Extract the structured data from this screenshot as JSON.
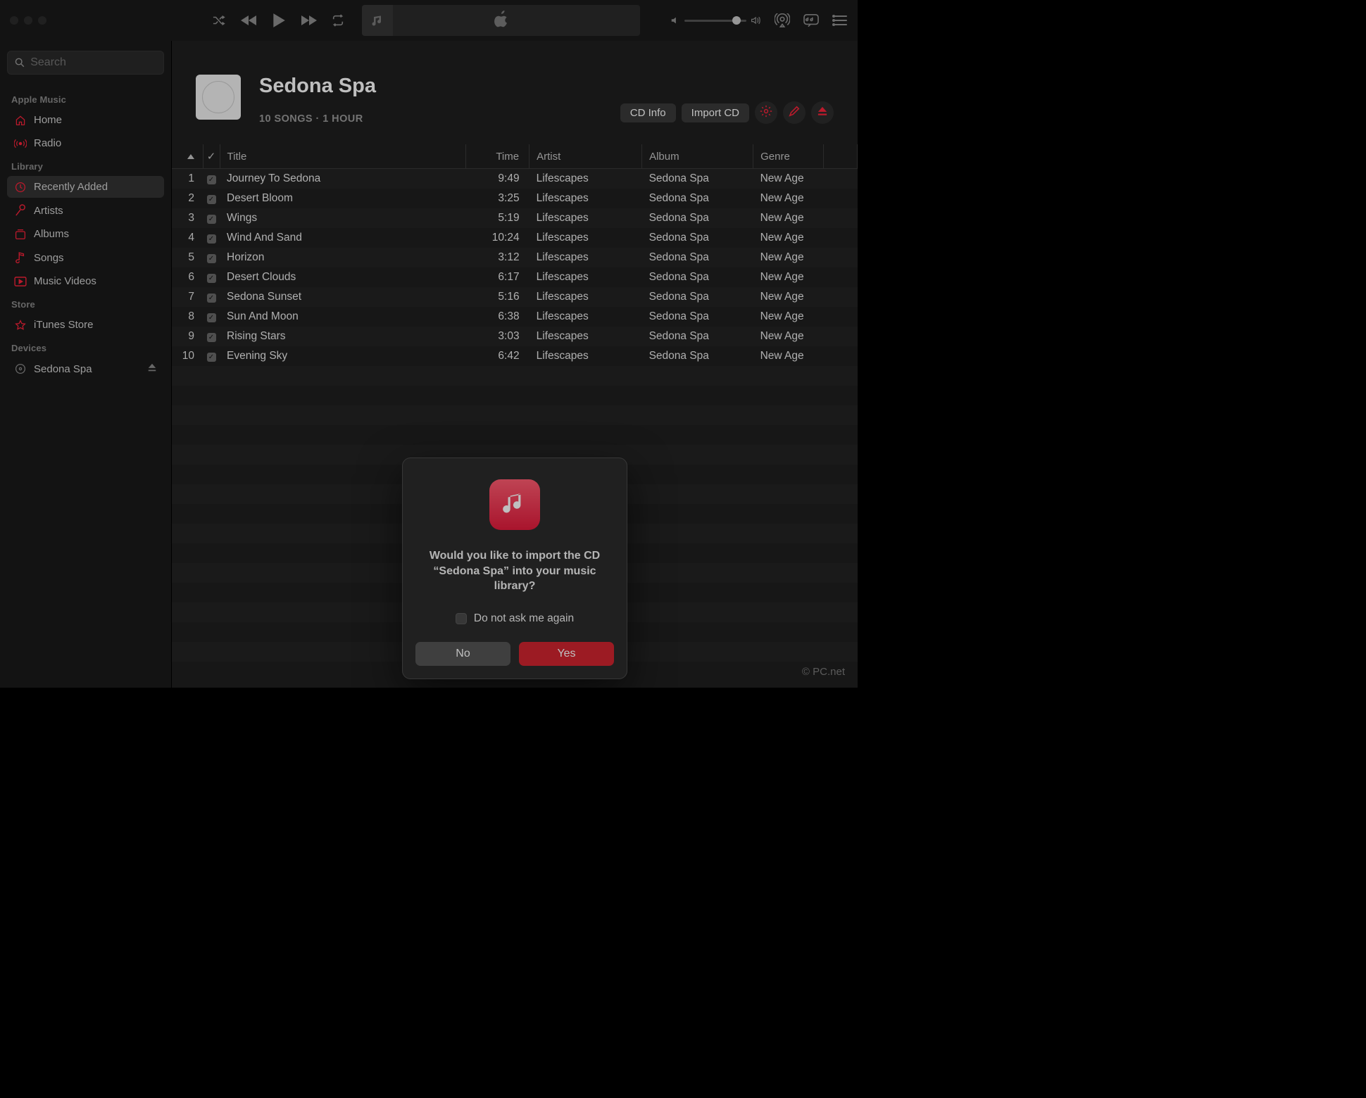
{
  "search": {
    "placeholder": "Search"
  },
  "sidebar": {
    "sections": {
      "apple_music": {
        "label": "Apple Music",
        "items": [
          {
            "label": "Home"
          },
          {
            "label": "Radio"
          }
        ]
      },
      "library": {
        "label": "Library",
        "items": [
          {
            "label": "Recently Added"
          },
          {
            "label": "Artists"
          },
          {
            "label": "Albums"
          },
          {
            "label": "Songs"
          },
          {
            "label": "Music Videos"
          }
        ]
      },
      "store": {
        "label": "Store",
        "items": [
          {
            "label": "iTunes Store"
          }
        ]
      },
      "devices": {
        "label": "Devices",
        "items": [
          {
            "label": "Sedona Spa"
          }
        ]
      }
    }
  },
  "header": {
    "title": "Sedona Spa",
    "subtitle": "10 SONGS · 1 HOUR",
    "cd_info": "CD Info",
    "import_cd": "Import CD"
  },
  "columns": {
    "num": "",
    "chk": "✓",
    "title": "Title",
    "time": "Time",
    "artist": "Artist",
    "album": "Album",
    "genre": "Genre"
  },
  "tracks": [
    {
      "n": "1",
      "title": "Journey To Sedona",
      "time": "9:49",
      "artist": "Lifescapes",
      "album": "Sedona Spa",
      "genre": "New Age"
    },
    {
      "n": "2",
      "title": "Desert Bloom",
      "time": "3:25",
      "artist": "Lifescapes",
      "album": "Sedona Spa",
      "genre": "New Age"
    },
    {
      "n": "3",
      "title": "Wings",
      "time": "5:19",
      "artist": "Lifescapes",
      "album": "Sedona Spa",
      "genre": "New Age"
    },
    {
      "n": "4",
      "title": "Wind And Sand",
      "time": "10:24",
      "artist": "Lifescapes",
      "album": "Sedona Spa",
      "genre": "New Age"
    },
    {
      "n": "5",
      "title": "Horizon",
      "time": "3:12",
      "artist": "Lifescapes",
      "album": "Sedona Spa",
      "genre": "New Age"
    },
    {
      "n": "6",
      "title": "Desert Clouds",
      "time": "6:17",
      "artist": "Lifescapes",
      "album": "Sedona Spa",
      "genre": "New Age"
    },
    {
      "n": "7",
      "title": "Sedona Sunset",
      "time": "5:16",
      "artist": "Lifescapes",
      "album": "Sedona Spa",
      "genre": "New Age"
    },
    {
      "n": "8",
      "title": "Sun And Moon",
      "time": "6:38",
      "artist": "Lifescapes",
      "album": "Sedona Spa",
      "genre": "New Age"
    },
    {
      "n": "9",
      "title": "Rising Stars",
      "time": "3:03",
      "artist": "Lifescapes",
      "album": "Sedona Spa",
      "genre": "New Age"
    },
    {
      "n": "10",
      "title": "Evening Sky",
      "time": "6:42",
      "artist": "Lifescapes",
      "album": "Sedona Spa",
      "genre": "New Age"
    }
  ],
  "dialog": {
    "message": "Would you like to import the CD “Sedona Spa” into your music library?",
    "checkbox": "Do not ask me again",
    "no": "No",
    "yes": "Yes"
  },
  "watermark": "© PC.net"
}
